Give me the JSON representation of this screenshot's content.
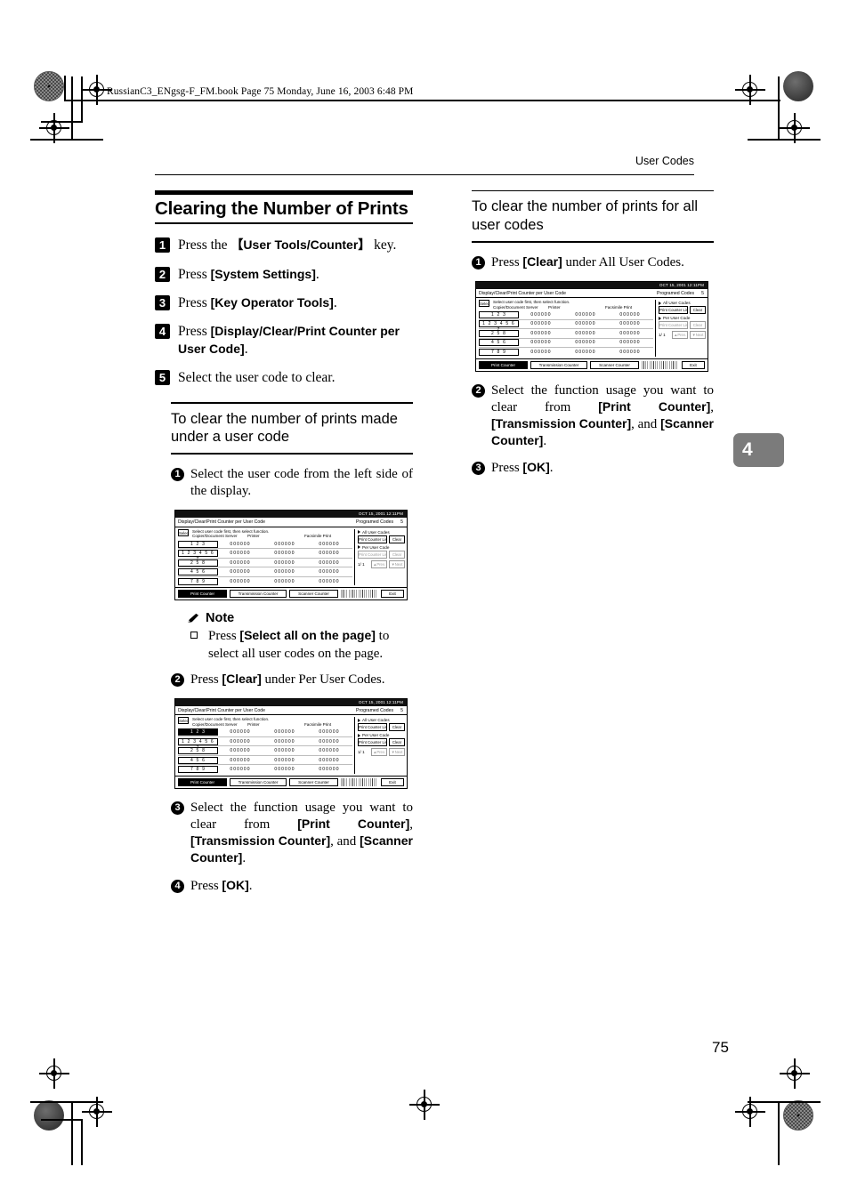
{
  "file_header": {
    "text": "RussianC3_ENgsg-F_FM.book  Page 75  Monday, June 16, 2003  6:48 PM"
  },
  "running_head": {
    "title": "User Codes"
  },
  "folio": {
    "page_number": "75"
  },
  "chapter_tab": {
    "number": "4",
    "color": "#7b7b7b"
  },
  "left_column": {
    "section_title": "Clearing the Number of Prints",
    "steps": [
      {
        "num": "1",
        "parts": [
          {
            "t": "Press the ",
            "b": false
          },
          {
            "t": "【User Tools/Counter】",
            "b": true
          },
          {
            "t": " key.",
            "b": false
          }
        ]
      },
      {
        "num": "2",
        "parts": [
          {
            "t": "Press ",
            "b": false
          },
          {
            "t": "[System Settings]",
            "b": true
          },
          {
            "t": ".",
            "b": false
          }
        ]
      },
      {
        "num": "3",
        "parts": [
          {
            "t": "Press ",
            "b": false
          },
          {
            "t": "[Key Operator Tools]",
            "b": true
          },
          {
            "t": ".",
            "b": false
          }
        ]
      },
      {
        "num": "4",
        "parts": [
          {
            "t": "Press ",
            "b": false
          },
          {
            "t": "[Display/Clear/Print Counter per User Code]",
            "b": true
          },
          {
            "t": ".",
            "b": false
          }
        ]
      },
      {
        "num": "5",
        "parts": [
          {
            "t": "Select the user code to clear.",
            "b": false
          }
        ]
      }
    ],
    "subsection_title": "To clear the number of prints made under a user code",
    "substeps_a": [
      {
        "num": "1",
        "parts": [
          {
            "t": "Select the user code from the left side of the display.",
            "b": false
          }
        ]
      }
    ],
    "note": {
      "label": "Note",
      "icon": "pencil-icon",
      "items": [
        {
          "parts": [
            {
              "t": "Press ",
              "b": false
            },
            {
              "t": "[Select all on the page]",
              "b": true
            },
            {
              "t": " to select all user codes on the page.",
              "b": false
            }
          ]
        }
      ]
    },
    "substeps_b": [
      {
        "num": "2",
        "parts": [
          {
            "t": "Press ",
            "b": false
          },
          {
            "t": "[Clear]",
            "b": true
          },
          {
            "t": " under Per User Codes.",
            "b": false
          }
        ]
      }
    ],
    "substeps_c": [
      {
        "num": "3",
        "parts": [
          {
            "t": "Select the function usage you want to clear from ",
            "b": false
          },
          {
            "t": "[Print Counter]",
            "b": true
          },
          {
            "t": ", ",
            "b": false
          },
          {
            "t": "[Transmission Counter]",
            "b": true
          },
          {
            "t": ", and ",
            "b": false
          },
          {
            "t": "[Scanner Counter]",
            "b": true
          },
          {
            "t": ".",
            "b": false
          }
        ]
      },
      {
        "num": "4",
        "parts": [
          {
            "t": "Press ",
            "b": false
          },
          {
            "t": "[OK]",
            "b": true
          },
          {
            "t": ".",
            "b": false
          }
        ]
      }
    ]
  },
  "right_column": {
    "subsection_title": "To clear the number of prints for all user codes",
    "substeps_a": [
      {
        "num": "1",
        "parts": [
          {
            "t": "Press ",
            "b": false
          },
          {
            "t": "[Clear]",
            "b": true
          },
          {
            "t": " under All User Codes.",
            "b": false
          }
        ]
      }
    ],
    "substeps_b": [
      {
        "num": "2",
        "parts": [
          {
            "t": "Select the function usage you want to clear from ",
            "b": false
          },
          {
            "t": "[Print Counter]",
            "b": true
          },
          {
            "t": ", ",
            "b": false
          },
          {
            "t": "[Transmission Counter]",
            "b": true
          },
          {
            "t": ", and ",
            "b": false
          },
          {
            "t": "[Scanner Counter]",
            "b": true
          },
          {
            "t": ".",
            "b": false
          }
        ]
      },
      {
        "num": "3",
        "parts": [
          {
            "t": "Press ",
            "b": false
          },
          {
            "t": "[OK]",
            "b": true
          },
          {
            "t": ".",
            "b": false
          }
        ]
      }
    ]
  },
  "lcd": {
    "timebar": "OCT  15, 2001  12:11PM",
    "title": "Display/Clear/Print Counter per User Code",
    "programed_label": "Programed Codes",
    "programed_count": "5",
    "select_all_button": "Select all on the page",
    "hint": "Select user code first, then select function.",
    "columns": [
      "Copier/Document Server",
      "Printer",
      "Facsimile Print"
    ],
    "rows": [
      {
        "code": "1 2 3",
        "counts": [
          "000000",
          "000000",
          "000000"
        ]
      },
      {
        "code": "1 2 3 4 5 6 7",
        "counts": [
          "000000",
          "000000",
          "000000"
        ]
      },
      {
        "code": "2 5 8",
        "counts": [
          "000000",
          "000000",
          "000000"
        ]
      },
      {
        "code": "4 5 6",
        "counts": [
          "000000",
          "000000",
          "000000"
        ]
      },
      {
        "code": "7 8 9",
        "counts": [
          "000000",
          "000000",
          "000000"
        ]
      }
    ],
    "all_user_codes_label": "All User Codes",
    "per_user_code_label": "Per User Code",
    "print_counter_list_button": "Print Counter List",
    "clear_button": "Clear",
    "page_indicator": "1/  1",
    "prev_button": "▲Prev.",
    "next_button": "▼Next",
    "tabs": [
      "Print Counter",
      "Transmission Counter",
      "Scanner Counter"
    ],
    "exit_button": "Exit"
  }
}
